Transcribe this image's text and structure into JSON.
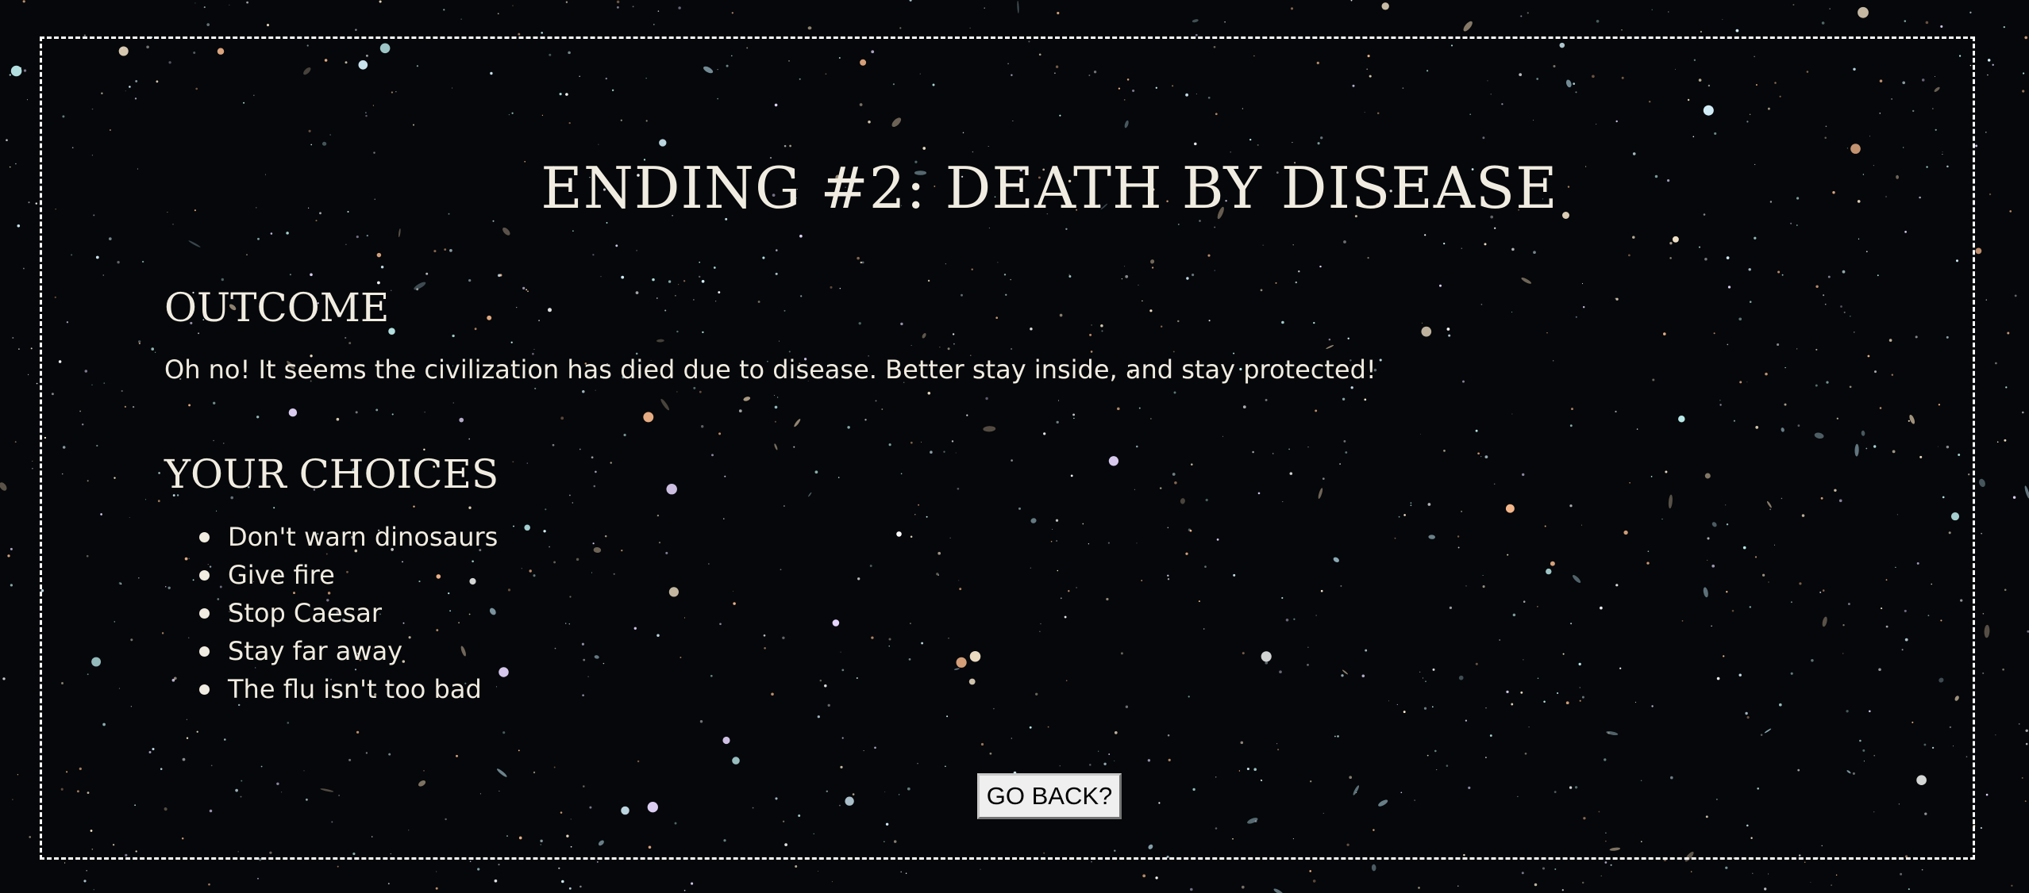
{
  "page": {
    "title": "ENDING #2: DEATH BY DISEASE"
  },
  "outcome": {
    "heading": "OUTCOME",
    "text": "Oh no! It seems the civilization has died due to disease. Better stay inside, and stay protected!"
  },
  "choices": {
    "heading": "YOUR CHOICES",
    "items": [
      {
        "label": "Don't warn dinosaurs"
      },
      {
        "label": "Give fire"
      },
      {
        "label": "Stop Caesar"
      },
      {
        "label": "Stay far away"
      },
      {
        "label": "The flu isn't too bad"
      }
    ]
  },
  "actions": {
    "go_back_label": "GO BACK?"
  },
  "colors": {
    "background": "#05070a",
    "text": "#f1ece1",
    "frame_border": "#ffffff",
    "button_background": "#efefef",
    "button_text": "#000000"
  },
  "decorations": {
    "background": "starfield"
  }
}
